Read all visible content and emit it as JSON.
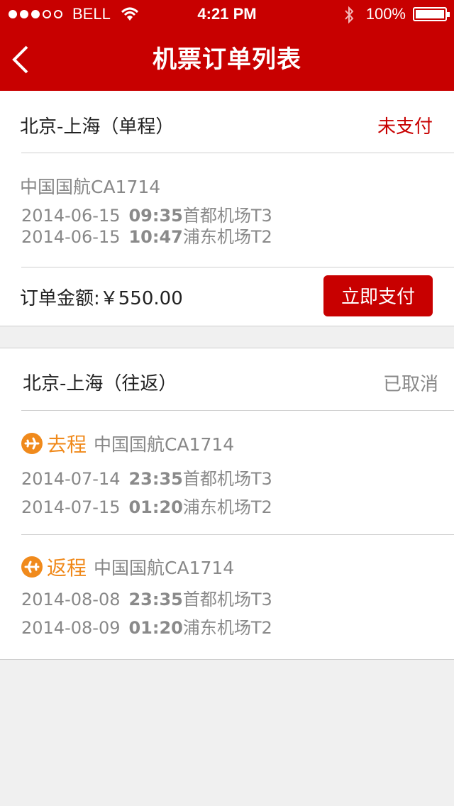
{
  "status_bar": {
    "carrier": "BELL",
    "time": "4:21 PM",
    "battery": "100%"
  },
  "nav": {
    "title": "机票订单列表",
    "back_icon": "chevron-left-icon"
  },
  "colors": {
    "brand_red": "#c80000",
    "accent_orange": "#f08a1c",
    "muted_gray": "#888888"
  },
  "orders": [
    {
      "route": "北京-上海（单程）",
      "status": "未支付",
      "airline": "中国国航CA1714",
      "departure": {
        "date": "2014-06-15",
        "time": "09:35",
        "airport": "首都机场T3"
      },
      "arrival": {
        "date": "2014-06-15",
        "time": "10:47",
        "airport": "浦东机场T2"
      },
      "amount_label": "订单金额:",
      "amount": "￥550.00",
      "pay_label": "立即支付"
    },
    {
      "route": "北京-上海（往返）",
      "status": "已取消",
      "outbound": {
        "tag": "去程",
        "airline": "中国国航CA1714",
        "departure": {
          "date": "2014-07-14",
          "time": "23:35",
          "airport": "首都机场T3"
        },
        "arrival": {
          "date": "2014-07-15",
          "time": "01:20",
          "airport": "浦东机场T2"
        }
      },
      "return": {
        "tag": "返程",
        "airline": "中国国航CA1714",
        "departure": {
          "date": "2014-08-08",
          "time": "23:35",
          "airport": "首都机场T3"
        },
        "arrival": {
          "date": "2014-08-09",
          "time": "01:20",
          "airport": "浦东机场T2"
        }
      }
    }
  ]
}
